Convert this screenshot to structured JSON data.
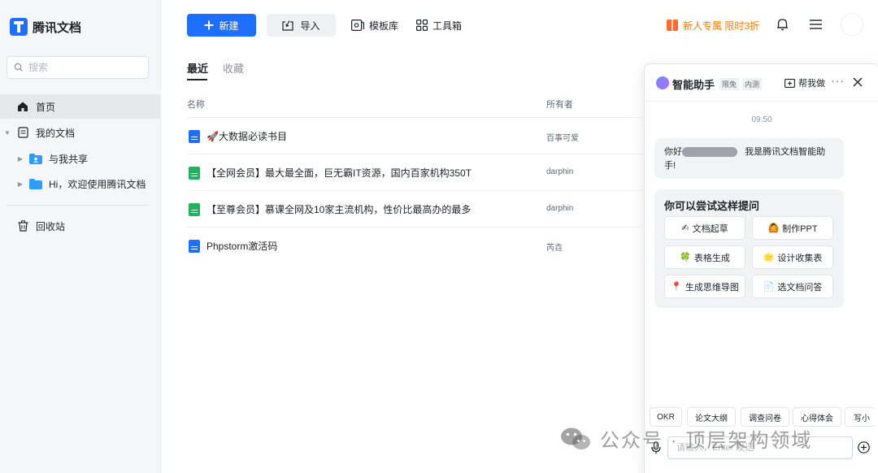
{
  "app": {
    "name": "腾讯文档"
  },
  "sidebar": {
    "search_placeholder": "搜索",
    "items": [
      {
        "label": "首页"
      },
      {
        "label": "我的文档"
      },
      {
        "label": "与我共享"
      },
      {
        "label": "Hi，欢迎使用腾讯文档"
      },
      {
        "label": "回收站"
      }
    ]
  },
  "toolbar": {
    "new_label": "新建",
    "import_label": "导入",
    "templates_label": "模板库",
    "toolbox_label": "工具箱",
    "promo_label": "新人专属 限时3折"
  },
  "tabs": [
    {
      "label": "最近"
    },
    {
      "label": "收藏"
    }
  ],
  "table": {
    "columns": {
      "name": "名称",
      "owner": "所有者"
    },
    "rows": [
      {
        "name": "🚀大数据必读书目",
        "owner": "百事可爱",
        "type": "doc"
      },
      {
        "name": "【全网会员】最大最全面，巨无霸IT资源，国内百家机构350T",
        "owner": "darphin",
        "type": "sheet"
      },
      {
        "name": "【至尊会员】慕课全网及10家主流机构，性价比最高办的最多",
        "owner": "darphin",
        "type": "sheet"
      },
      {
        "name": "Phpstorm激活码",
        "owner": "芮垚",
        "type": "doc"
      }
    ]
  },
  "assistant": {
    "title": "智能助手",
    "tag_free": "限免",
    "tag_beta": "内测",
    "help_label": "帮我做",
    "time": "09:50",
    "greeting_prefix": "你好",
    "greeting_suffix": "我是腾讯文档智能助手!",
    "suggest_title": "你可以尝试这样提问",
    "chips": [
      {
        "icon": "✍",
        "label": "文档起草"
      },
      {
        "icon": "🙆",
        "label": "制作PPT"
      },
      {
        "icon": "🍀",
        "label": "表格生成"
      },
      {
        "icon": "🌟",
        "label": "设计收集表"
      },
      {
        "icon": "📍",
        "label": "生成思维导图"
      },
      {
        "icon": "📄",
        "label": "选文档问答"
      }
    ],
    "quick": [
      "OKR",
      "论文大纲",
      "调查问卷",
      "心得体会",
      "写小"
    ],
    "input_placeholder": "请输入，Enter 发送"
  },
  "watermark": {
    "text": "公众号 · 顶层架构领域"
  }
}
